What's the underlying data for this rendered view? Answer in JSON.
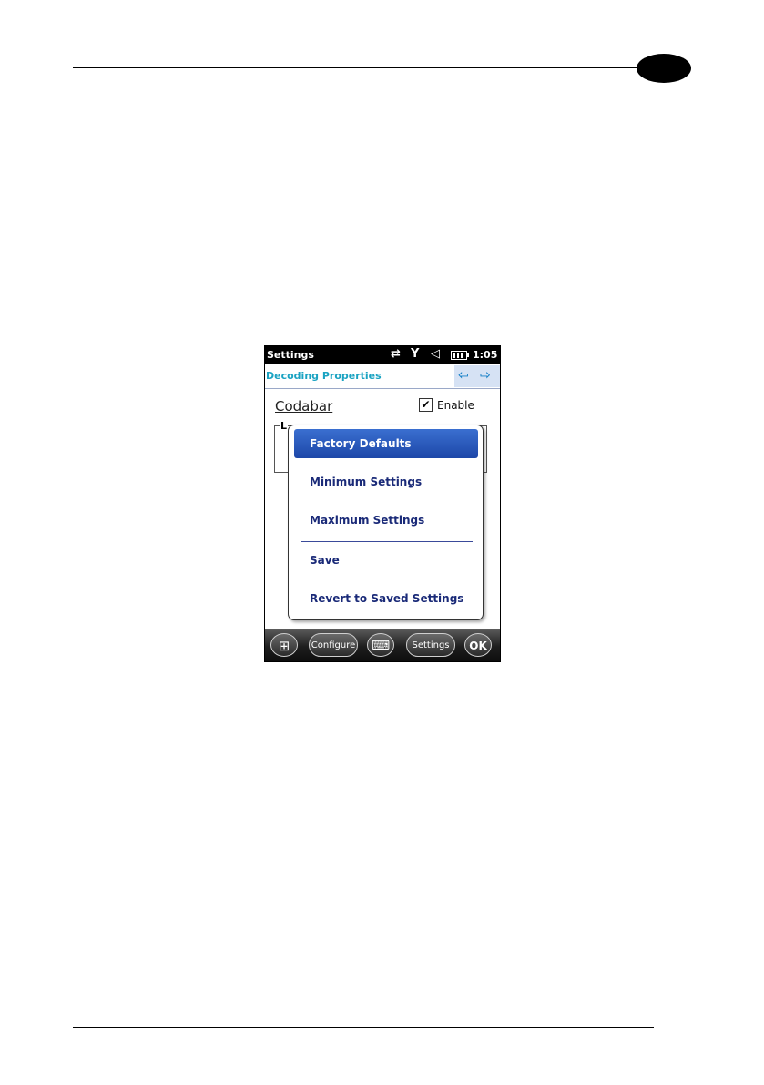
{
  "device": {
    "status_bar": {
      "title": "Settings",
      "time": "1:05",
      "icons": [
        "sync-arrows-icon",
        "no-signal-icon",
        "speaker-muted-icon",
        "battery-icon"
      ]
    },
    "header": {
      "title": "Decoding Properties",
      "prev_glyph": "⇦",
      "next_glyph": "⇨"
    },
    "content": {
      "symbology": "Codabar",
      "enable_label": "Enable",
      "enable_checked": true,
      "check_glyph": "✔",
      "group_label": "L"
    },
    "menu": {
      "items": [
        {
          "label": "Factory Defaults",
          "selected": true
        },
        {
          "label": "Minimum Settings",
          "selected": false
        },
        {
          "label": "Maximum Settings",
          "selected": false
        },
        {
          "label": "Save",
          "selected": false
        },
        {
          "label": "Revert to Saved Settings",
          "selected": false
        }
      ]
    },
    "taskbar": {
      "start_glyph": "⊞",
      "configure_label": "Configure",
      "keyboard_glyph": "⌨",
      "settings_label": "Settings",
      "ok_label": "OK"
    },
    "colors": {
      "header_title": "#1aa3c2",
      "menu_text": "#1a2a78",
      "menu_selected": "#2552b8"
    }
  }
}
